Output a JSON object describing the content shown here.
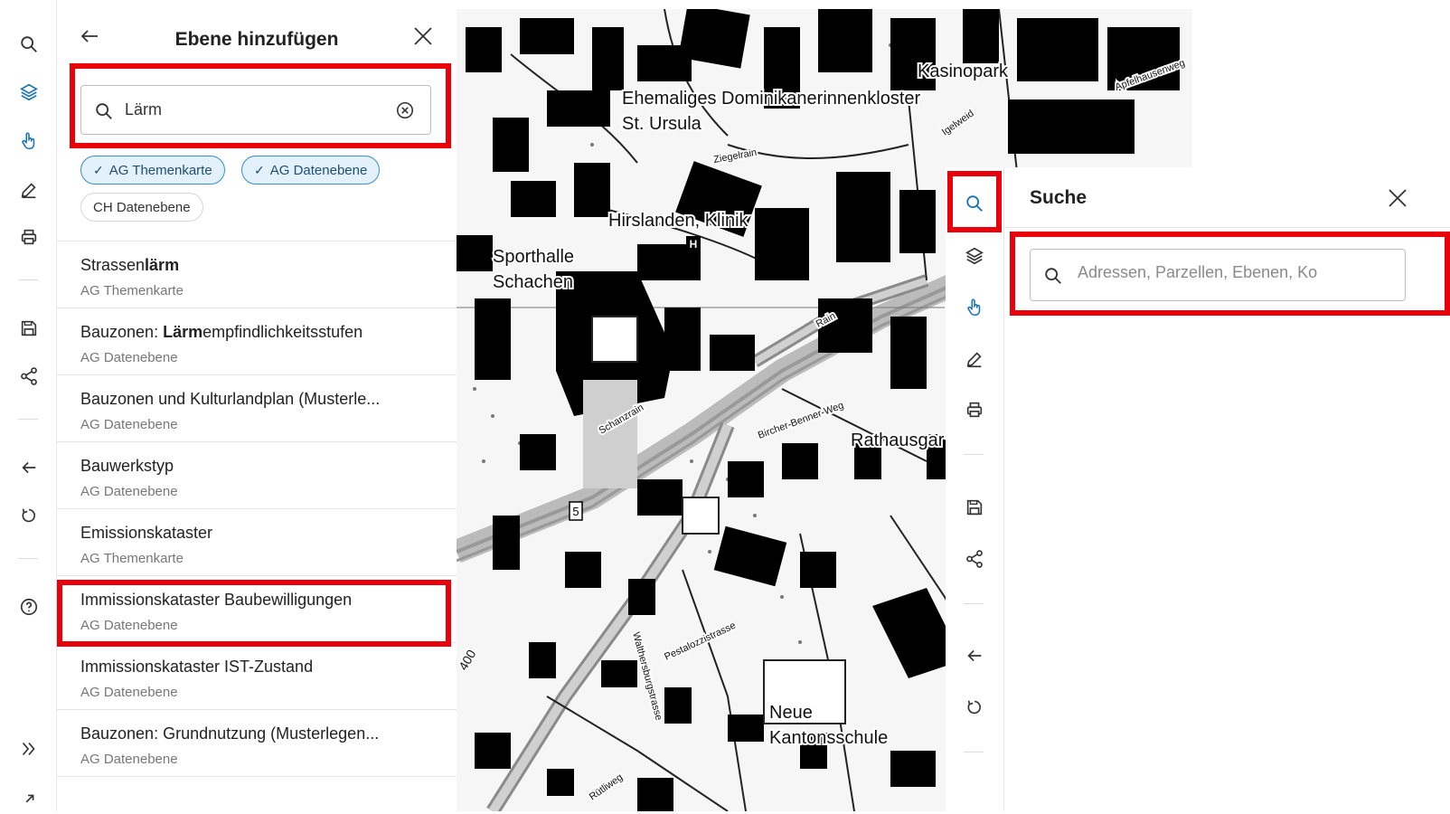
{
  "colors": {
    "accent": "#1a73b8",
    "highlight_box": "#e8000b",
    "chip_active_bg": "#e3f1fb",
    "chip_active_border": "#3c8dc8"
  },
  "left_toolbar": {
    "items": [
      {
        "icon": "search-icon",
        "active": false
      },
      {
        "icon": "layers-icon",
        "active": true
      },
      {
        "icon": "hand-pointer-icon",
        "active": true
      },
      {
        "icon": "pencil-icon",
        "active": false
      },
      {
        "icon": "printer-icon",
        "active": false
      },
      {
        "icon": "save-icon",
        "active": false
      },
      {
        "icon": "share-icon",
        "active": false
      },
      {
        "icon": "arrow-left-icon",
        "active": false
      },
      {
        "icon": "reset-icon",
        "active": false
      },
      {
        "icon": "help-icon",
        "active": false
      },
      {
        "icon": "expand-double-chevron-icon",
        "active": false
      }
    ]
  },
  "layer_panel": {
    "title": "Ebene hinzufügen",
    "search_value": "Lärm",
    "filters": [
      {
        "label": "AG Themenkarte",
        "active": true
      },
      {
        "label": "AG Datenebene",
        "active": true
      },
      {
        "label": "CH Datenebene",
        "active": false
      }
    ],
    "results": [
      {
        "pre": "Strassen",
        "match": "lärm",
        "post": "",
        "type": "AG Themenkarte"
      },
      {
        "pre": "Bauzonen: ",
        "match": "Lärm",
        "post": "empfindlichkeitsstufen",
        "type": "AG Datenebene"
      },
      {
        "pre": "Bauzonen und Kulturlandplan (Musterle...",
        "match": "",
        "post": "",
        "type": "AG Datenebene"
      },
      {
        "pre": "Bauwerkstyp",
        "match": "",
        "post": "",
        "type": "AG Datenebene"
      },
      {
        "pre": "Emissionskataster",
        "match": "",
        "post": "",
        "type": "AG Themenkarte"
      },
      {
        "pre": "Immissionskataster Baubewilligungen",
        "match": "",
        "post": "",
        "type": "AG Datenebene"
      },
      {
        "pre": "Immissionskataster IST-Zustand",
        "match": "",
        "post": "",
        "type": "AG Datenebene"
      },
      {
        "pre": "Bauzonen: Grundnutzung (Musterlegen...",
        "match": "",
        "post": "",
        "type": "AG Datenebene"
      }
    ]
  },
  "map": {
    "labels": {
      "kasinopark": "Kasinopark",
      "kloster": "Ehemaliges Dominikanerinnenkloster",
      "ursula": "St. Ursula",
      "klinik": "Hirslanden, Klinik",
      "sporthalle": "Sporthalle",
      "schachen": "Schachen",
      "rathaus": "Rathausgar",
      "neue": "Neue",
      "kantonsschule": "Kantonsschule",
      "schild": "5",
      "hospital": "H",
      "elevation": "400",
      "strasse_rain": "Rain",
      "strasse_schanzrain": "Schanzrain",
      "strasse_ziegelrain": "Ziegelrain",
      "strasse_apfelhausen": "Apfelhausenweg",
      "strasse_pestalozzi": "Pestalozzistrasse",
      "strasse_walthersburg": "Walthersburgstrasse",
      "strasse_igelweid": "Igelweid",
      "strasse_rutliweg": "Rütliweg",
      "strasse_bircher": "Bircher-Benner-Weg"
    }
  },
  "search_panel": {
    "title": "Suche",
    "placeholder": "Adressen, Parzellen, Ebenen, Ko",
    "toolbar": [
      {
        "icon": "search-icon",
        "active": true
      },
      {
        "icon": "layers-icon",
        "active": false
      },
      {
        "icon": "hand-pointer-icon",
        "active": true
      },
      {
        "icon": "pencil-icon",
        "active": false
      },
      {
        "icon": "printer-icon",
        "active": false
      },
      {
        "icon": "save-icon",
        "active": false
      },
      {
        "icon": "share-icon",
        "active": false
      },
      {
        "icon": "arrow-left-icon",
        "active": false
      },
      {
        "icon": "reset-icon",
        "active": false
      }
    ]
  }
}
